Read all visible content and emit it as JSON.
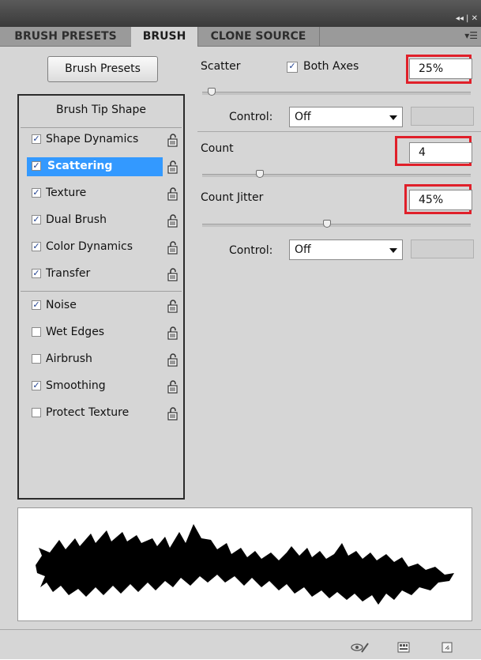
{
  "window": {
    "controls": "◂◂ | ✕"
  },
  "tabs": [
    {
      "label": "BRUSH PRESETS"
    },
    {
      "label": "BRUSH"
    },
    {
      "label": "CLONE SOURCE"
    }
  ],
  "panel_menu_icon": "panel-menu-icon",
  "brush_presets_button": "Brush Presets",
  "sidebar": {
    "tip_shape_label": "Brush Tip Shape",
    "items": [
      {
        "label": "Shape Dynamics",
        "checked": true
      },
      {
        "label": "Scattering",
        "checked": true,
        "selected": true
      },
      {
        "label": "Texture",
        "checked": true
      },
      {
        "label": "Dual Brush",
        "checked": true
      },
      {
        "label": "Color Dynamics",
        "checked": true
      },
      {
        "label": "Transfer",
        "checked": true
      },
      {
        "label": "Noise",
        "checked": true
      },
      {
        "label": "Wet Edges",
        "checked": false
      },
      {
        "label": "Airbrush",
        "checked": false
      },
      {
        "label": "Smoothing",
        "checked": true
      },
      {
        "label": "Protect Texture",
        "checked": false
      }
    ]
  },
  "scatter": {
    "label": "Scatter",
    "both_axes_label": "Both Axes",
    "both_axes_checked": true,
    "value": "25%",
    "slider_fraction": 0.02
  },
  "scatter_control": {
    "label": "Control:",
    "value": "Off"
  },
  "count": {
    "label": "Count",
    "value": "4",
    "slider_fraction": 0.2
  },
  "count_jitter": {
    "label": "Count Jitter",
    "value": "45%",
    "slider_fraction": 0.45
  },
  "jitter_control": {
    "label": "Control:",
    "value": "Off"
  },
  "colors": {
    "highlight": "#e0202a",
    "selection": "#3399ff"
  },
  "bottom_icons": [
    "toggle-live-tip-preview-icon",
    "create-new-brush-icon",
    "new-preset-icon"
  ]
}
